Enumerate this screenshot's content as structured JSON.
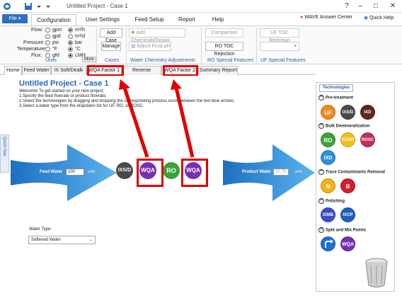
{
  "window": {
    "title": "Untitled Project - Case 1"
  },
  "menu": {
    "file": "File",
    "tabs": [
      "Configuration",
      "User Settings",
      "Feed Setup",
      "Report",
      "Help"
    ],
    "answer_center": "WAVE Answer Center",
    "quick_help": "Quick Help"
  },
  "ribbon": {
    "units": {
      "label": "Units",
      "rows": [
        {
          "name": "Flow:",
          "opt1": "gpm",
          "opt2": "m³/h",
          "selected": 2
        },
        {
          "name": "",
          "opt1": "gpd",
          "opt2": "m³/d",
          "selected": 0
        },
        {
          "name": "Pressure:",
          "opt1": "psi",
          "opt2": "bar",
          "selected": 2
        },
        {
          "name": "Temperature:",
          "opt1": "°F",
          "opt2": "°C",
          "selected": 2
        },
        {
          "name": "Flux:",
          "opt1": "gfd",
          "opt2": "LMH",
          "selected": 2
        }
      ],
      "more": "More"
    },
    "cases": {
      "label": "Cases",
      "add": "Add Case",
      "manage": "Manage"
    },
    "chem": {
      "label": "Water Chemistry Adjustments",
      "add": "Add Chemicals/Degas",
      "adjust": "Adjust Final pH"
    },
    "ro": {
      "label": "RO Special Features",
      "compaction": "Compaction",
      "toc": "RO TOC Rejection"
    },
    "uf": {
      "label": "UF Special Features",
      "toc": "UF TOC Rejection"
    }
  },
  "doc_tabs": [
    "Home",
    "Feed Water",
    "IX Soft/Dealk",
    "WQA Factor 1",
    "Reverse Osmosis",
    "WQA Factor 2",
    "Summary Report"
  ],
  "canvas": {
    "project_title": "Untitled Project - Case 1",
    "instructions": [
      "Welcome! To get started on your new project:",
      "1.Specify the feed flowrate or product flowrate.",
      "2.Select the technologies by dragging and dropping the corresponding process icons between the two blue arrows.",
      "3.Select a water type from the dropdown list for UF, RO, or ROSC."
    ],
    "feed_label": "Feed Water",
    "feed_value": "100",
    "feed_unit": "m³/h",
    "product_label": "Product Water",
    "product_value": "72.75",
    "product_unit": "m³/h",
    "process": [
      "IXS/D",
      "WQA",
      "RO",
      "WQA"
    ],
    "water_type_label": "Water Type:",
    "water_type_value": "Softened Water",
    "quick_nav": "Quick Nav"
  },
  "technologies": {
    "tab": "Technologies",
    "sections": [
      {
        "title": "Pre-treatment",
        "items": [
          "UF",
          "IXS/D",
          "IXD"
        ]
      },
      {
        "title": "Bulk Demineralization",
        "items": [
          "RO",
          "CCRO",
          "ROSC",
          "IXD"
        ]
      },
      {
        "title": "Trace Contaminants Removal",
        "items": [
          "N",
          "B"
        ]
      },
      {
        "title": "Polishing",
        "items": [
          "IXMB",
          "IXCP"
        ]
      },
      {
        "title": "Split and Mix Points",
        "items": [
          "split",
          "WQA"
        ]
      }
    ]
  },
  "colors": {
    "accent": "#2a5db0",
    "arrow": "#2b86d6",
    "highlight": "#e00000",
    "uf": "#f08a1c",
    "ixs": "#4a4a4a",
    "ixd_brown": "#5a2a1a",
    "ro": "#3aa33a",
    "ccro": "#f2c21a",
    "rosc": "#c0305a",
    "ixd_blue": "#2f8fd8",
    "n": "#f2b21a",
    "b": "#d01f2a",
    "ixmb": "#3a4fc8",
    "ixcp": "#1f5fc0",
    "split": "#1f6fd0",
    "wqa": "#7a2fb0"
  }
}
